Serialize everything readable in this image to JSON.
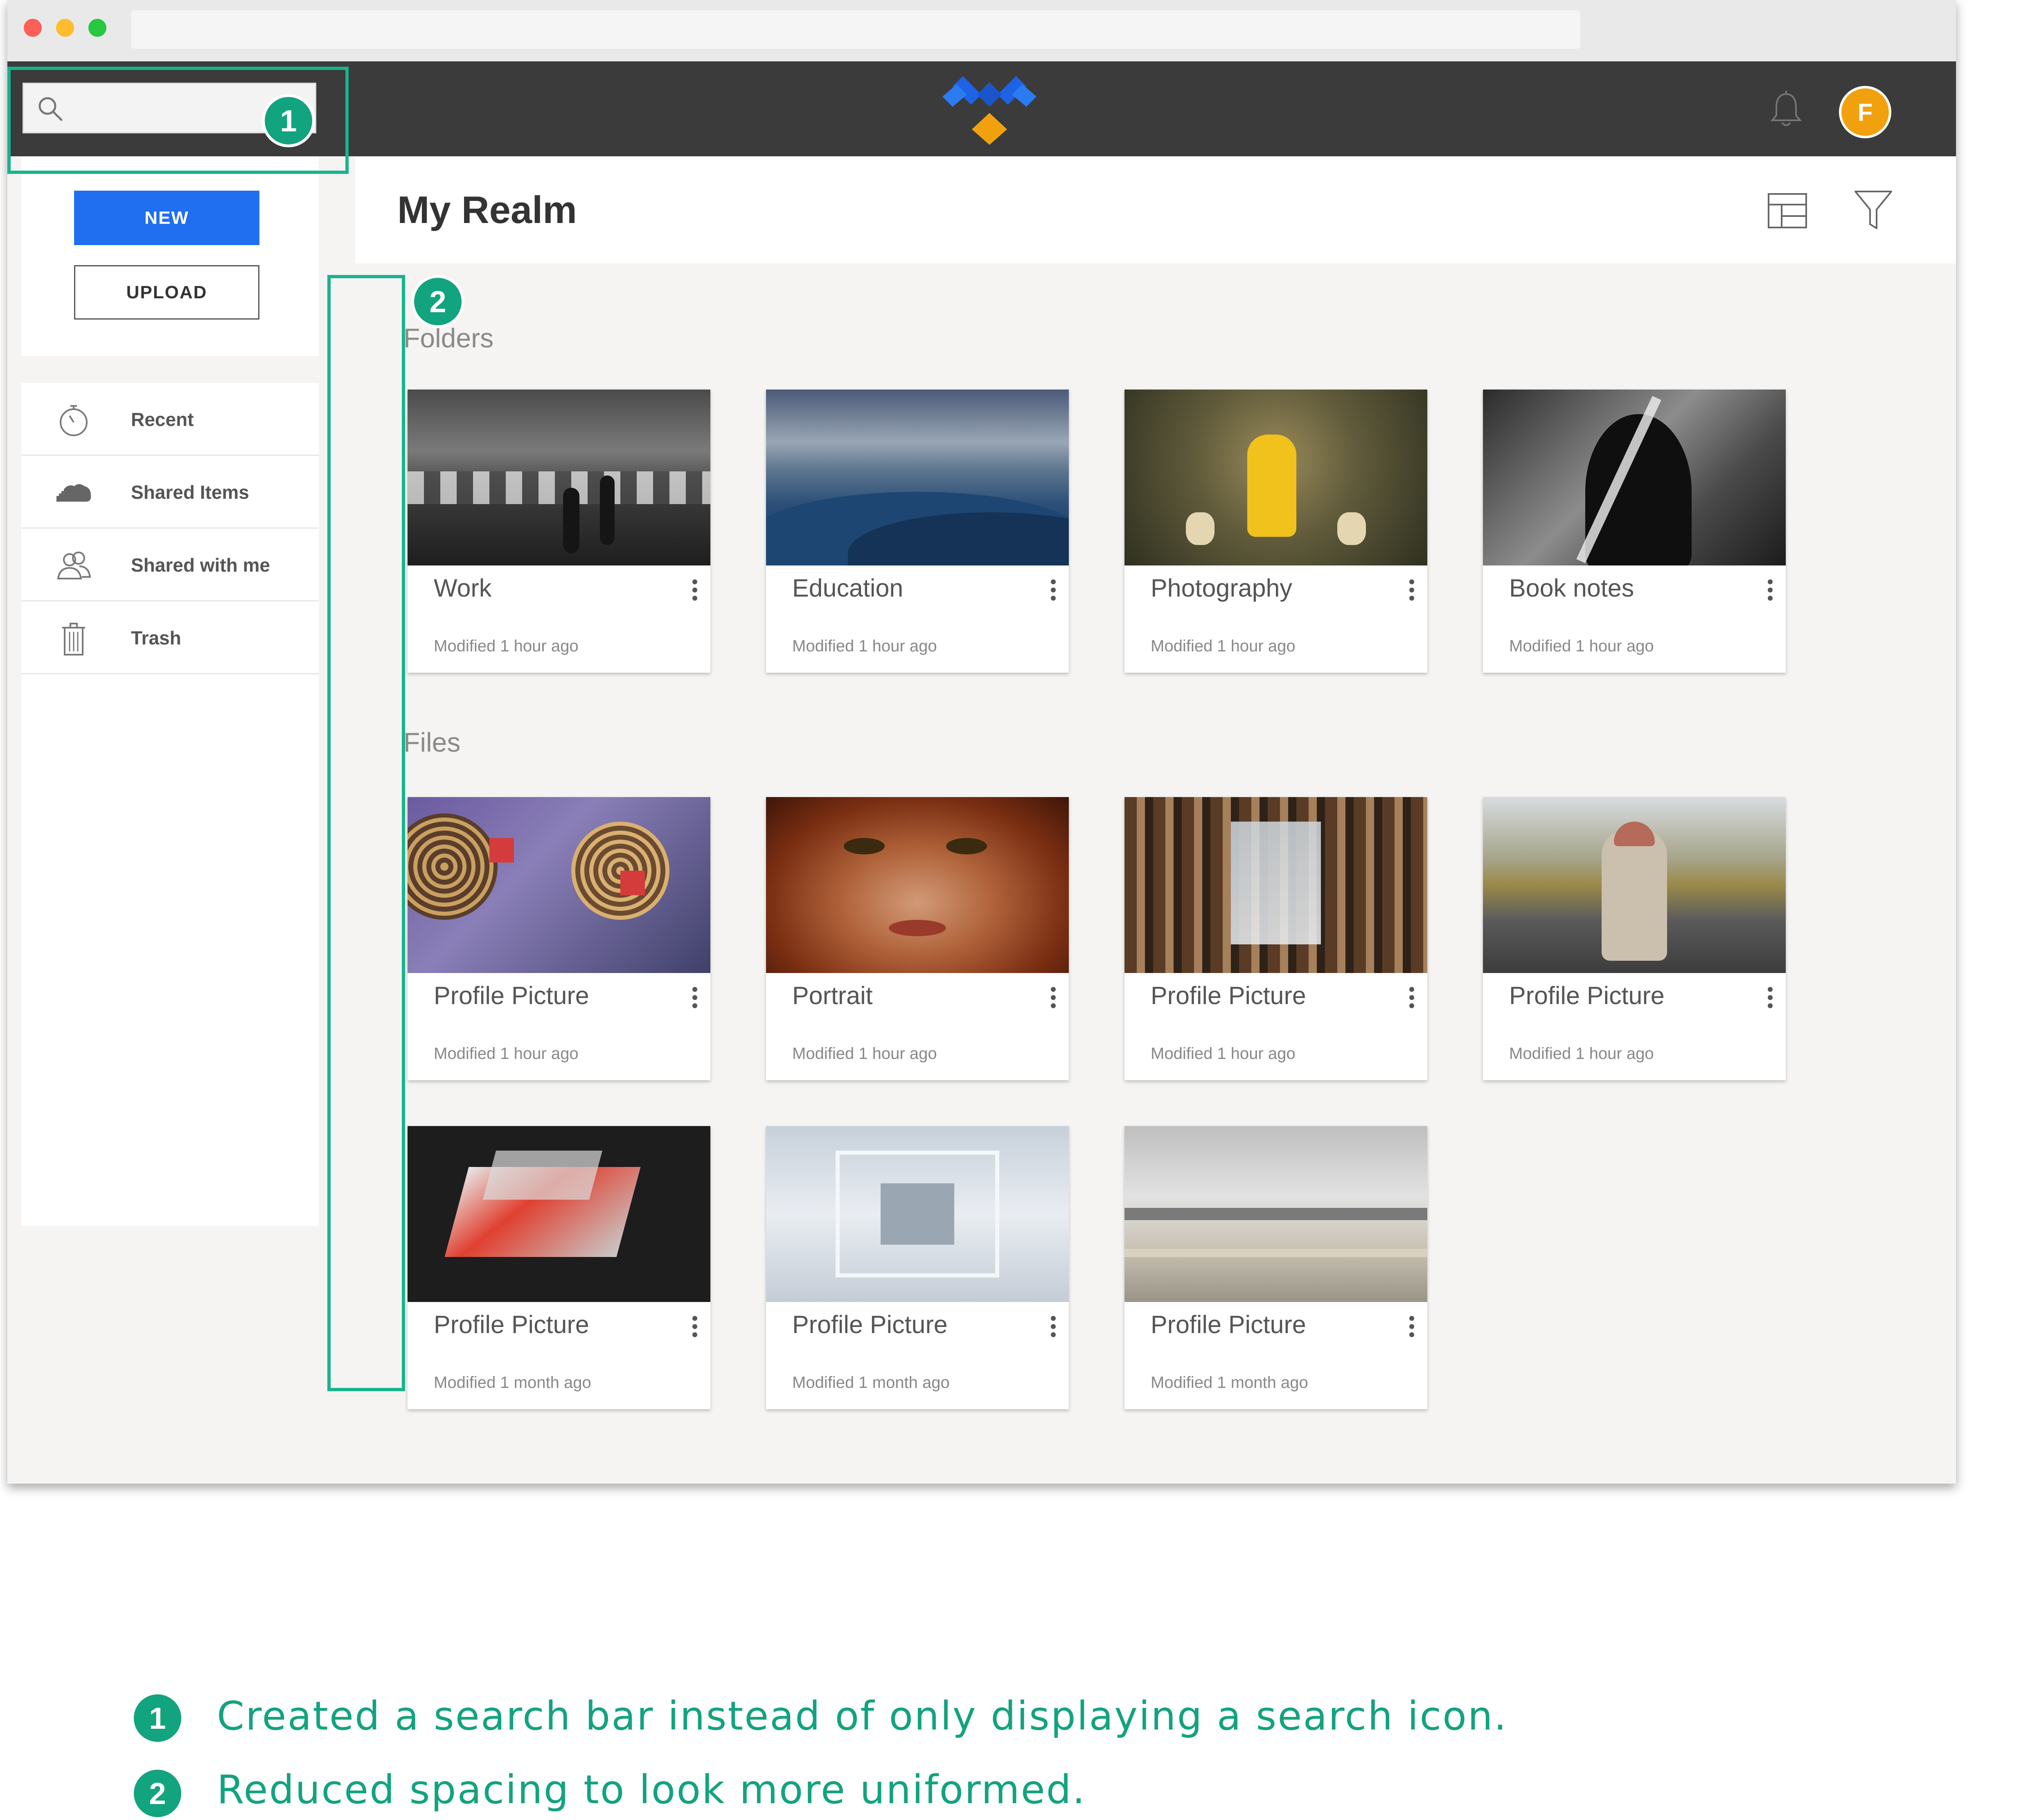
{
  "search": {
    "placeholder": ""
  },
  "user": {
    "avatar_initial": "F"
  },
  "sidebar": {
    "new_label": "NEW",
    "upload_label": "UPLOAD",
    "items": [
      {
        "label": "Recent",
        "icon": "stopwatch-icon"
      },
      {
        "label": "Shared Items",
        "icon": "cloud-icon"
      },
      {
        "label": "Shared with me",
        "icon": "users-icon"
      },
      {
        "label": "Trash",
        "icon": "trash-icon"
      }
    ]
  },
  "main": {
    "title": "My Realm",
    "folders_heading": "Folders",
    "files_heading": "Files",
    "folders": [
      {
        "name": "Work",
        "modified": "Modified 1 hour ago"
      },
      {
        "name": "Education",
        "modified": "Modified 1 hour ago"
      },
      {
        "name": "Photography",
        "modified": "Modified 1 hour ago"
      },
      {
        "name": "Book notes",
        "modified": "Modified 1 hour ago"
      }
    ],
    "files": [
      {
        "name": "Profile Picture",
        "modified": "Modified 1 hour ago"
      },
      {
        "name": "Portrait",
        "modified": "Modified 1 hour ago"
      },
      {
        "name": "Profile Picture",
        "modified": "Modified 1 hour ago"
      },
      {
        "name": "Profile Picture",
        "modified": "Modified 1 hour ago"
      },
      {
        "name": "Profile Picture",
        "modified": "Modified 1 month ago"
      },
      {
        "name": "Profile Picture",
        "modified": "Modified 1 month ago"
      },
      {
        "name": "Profile Picture",
        "modified": "Modified 1 month ago"
      }
    ]
  },
  "annotations": [
    {
      "number": "1",
      "text": "Created a search bar instead of only displaying a search icon."
    },
    {
      "number": "2",
      "text": "Reduced spacing to look more uniformed."
    }
  ],
  "colors": {
    "accent_blue": "#1f6ff0",
    "annotation_green": "#12a37f",
    "avatar_orange": "#f2a10e",
    "appbar_dark": "#3b3b3b"
  }
}
